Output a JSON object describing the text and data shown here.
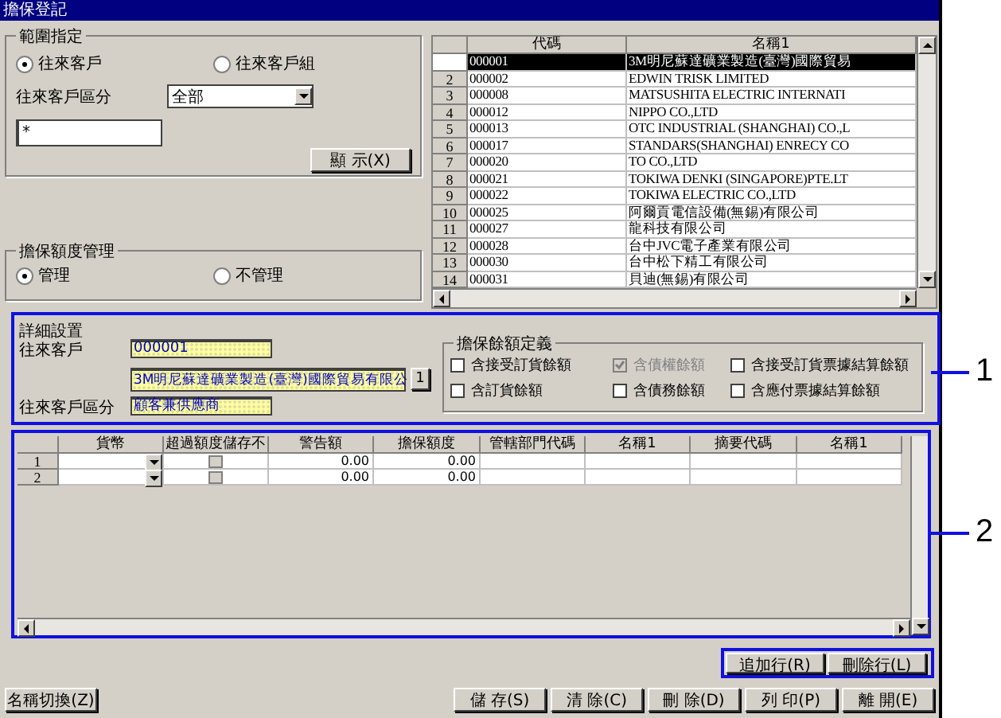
{
  "window": {
    "title": "擔保登記"
  },
  "range": {
    "title": "範圍指定",
    "options": [
      {
        "label": "往來客戶",
        "selected": true
      },
      {
        "label": "往來客戶組",
        "selected": false
      }
    ],
    "category_label": "往來客戶區分",
    "category_value": "全部",
    "filter_value": "*",
    "show_button": "顯 示(X)"
  },
  "credit_management": {
    "title": "擔保額度管理",
    "options": [
      {
        "label": "管理",
        "selected": true
      },
      {
        "label": "不管理",
        "selected": false
      }
    ]
  },
  "customer_table": {
    "columns": [
      "代碼",
      "名稱1"
    ],
    "rows": [
      {
        "number": "",
        "code": "000001",
        "name": "3M明尼蘇達礦業製造(臺灣)國際貿易",
        "selected": true
      },
      {
        "number": "2",
        "code": "000002",
        "name": "EDWIN TRISK LIMITED",
        "selected": false
      },
      {
        "number": "3",
        "code": "000008",
        "name": "MATSUSHITA ELECTRIC INTERNATI",
        "selected": false
      },
      {
        "number": "4",
        "code": "000012",
        "name": "NIPPO CO.,LTD",
        "selected": false
      },
      {
        "number": "5",
        "code": "000013",
        "name": "OTC INDUSTRIAL (SHANGHAI) CO.,L",
        "selected": false
      },
      {
        "number": "6",
        "code": "000017",
        "name": "STANDARS(SHANGHAI) ENRECY CO",
        "selected": false
      },
      {
        "number": "7",
        "code": "000020",
        "name": "TO CO.,LTD",
        "selected": false
      },
      {
        "number": "8",
        "code": "000021",
        "name": "TOKIWA DENKI (SINGAPORE)PTE.LT",
        "selected": false
      },
      {
        "number": "9",
        "code": "000022",
        "name": "TOKIWA ELECTRIC CO.,LTD",
        "selected": false
      },
      {
        "number": "10",
        "code": "000025",
        "name": "阿爾貢電信設備(無錫)有限公司",
        "selected": false
      },
      {
        "number": "11",
        "code": "000027",
        "name": "龍科技有限公司",
        "selected": false
      },
      {
        "number": "12",
        "code": "000028",
        "name": "台中JVC電子產業有限公司",
        "selected": false
      },
      {
        "number": "13",
        "code": "000030",
        "name": "台中松下精工有限公司",
        "selected": false
      },
      {
        "number": "14",
        "code": "000031",
        "name": "貝迪(無錫)有限公司",
        "selected": false
      }
    ]
  },
  "details": {
    "title": "詳細設置",
    "customer_label": "往來客戶",
    "customer_code": "000001",
    "customer_name": "3M明尼蘇達礦業製造(臺灣)國際貿易有限公",
    "lookup_button": "1",
    "category_label": "往來客戶區分",
    "category_value": "顧客兼供應商"
  },
  "balance_definition": {
    "title": "擔保餘額定義",
    "options": [
      {
        "label": "含接受訂貨餘額",
        "checked": false,
        "disabled": false
      },
      {
        "label": "含債權餘額",
        "checked": true,
        "disabled": true
      },
      {
        "label": "含接受訂貨票據結算餘額",
        "checked": false,
        "disabled": false
      },
      {
        "label": "含訂貨餘額",
        "checked": false,
        "disabled": false
      },
      {
        "label": "含債務餘額",
        "checked": false,
        "disabled": false
      },
      {
        "label": "含應付票據結算餘額",
        "checked": false,
        "disabled": false
      }
    ]
  },
  "limit_table": {
    "columns": [
      "貨幣",
      "超過額度儲存不",
      "警告額",
      "擔保額度",
      "管轄部門代碼",
      "名稱1",
      "摘要代碼",
      "名稱1"
    ],
    "rows": [
      {
        "number": "1",
        "warning": "0.00",
        "limit": "0.00",
        "checked": false
      },
      {
        "number": "2",
        "warning": "0.00",
        "limit": "0.00",
        "checked": false
      }
    ]
  },
  "row_buttons": [
    "追加行(R)",
    "刪除行(L)"
  ],
  "footer": {
    "left_button": "名稱切換(Z)",
    "buttons": [
      "儲 存(S)",
      "清 除(C)",
      "刪 除(D)",
      "列 印(P)",
      "離 開(E)"
    ]
  },
  "callouts": [
    "1",
    "2"
  ]
}
